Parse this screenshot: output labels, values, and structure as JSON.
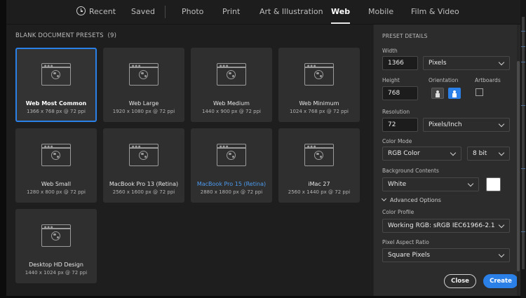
{
  "tabs": [
    {
      "label": "Recent",
      "icon": "clock-icon"
    },
    {
      "label": "Saved"
    },
    {
      "label": "Photo"
    },
    {
      "label": "Print"
    },
    {
      "label": "Art & Illustration"
    },
    {
      "label": "Web",
      "active": true
    },
    {
      "label": "Mobile"
    },
    {
      "label": "Film & Video"
    }
  ],
  "presets": {
    "header": "BLANK DOCUMENT PRESETS",
    "count": "(9)",
    "items": [
      {
        "name": "Web Most Common",
        "size": "1366 x 768 px @ 72 ppi",
        "selected": true
      },
      {
        "name": "Web Large",
        "size": "1920 x 1080 px @ 72 ppi"
      },
      {
        "name": "Web Medium",
        "size": "1440 x 900 px @ 72 ppi"
      },
      {
        "name": "Web Minimum",
        "size": "1024 x 768 px @ 72 ppi"
      },
      {
        "name": "Web Small",
        "size": "1280 x 800 px @ 72 ppi"
      },
      {
        "name": "MacBook Pro 13 (Retina)",
        "size": "2560 x 1600 px @ 72 ppi"
      },
      {
        "name": "MacBook Pro 15 (Retina)",
        "size": "2880 x 1800 px @ 72 ppi",
        "highlighted": true
      },
      {
        "name": "iMac 27",
        "size": "2560 x 1440 px @ 72 ppi"
      },
      {
        "name": "Desktop HD Design",
        "size": "1440 x 1024 px @ 72 ppi"
      }
    ]
  },
  "details": {
    "title": "PRESET DETAILS",
    "width_label": "Width",
    "width_value": "1366",
    "width_unit": "Pixels",
    "height_label": "Height",
    "height_value": "768",
    "orientation_label": "Orientation",
    "orientation_selected": "landscape",
    "artboards_label": "Artboards",
    "artboards_checked": false,
    "resolution_label": "Resolution",
    "resolution_value": "72",
    "resolution_unit": "Pixels/Inch",
    "color_mode_label": "Color Mode",
    "color_mode": "RGB Color",
    "bit_depth": "8 bit",
    "background_label": "Background Contents",
    "background": "White",
    "background_swatch": "#ffffff",
    "advanced_label": "Advanced Options",
    "color_profile_label": "Color Profile",
    "color_profile": "Working RGB: sRGB IEC61966-2.1",
    "pixel_aspect_label": "Pixel Aspect Ratio",
    "pixel_aspect": "Square Pixels"
  },
  "buttons": {
    "close": "Close",
    "create": "Create"
  },
  "colors": {
    "accent": "#2b80e8",
    "panel": "#2c2c2c",
    "background": "#1e1e1e"
  }
}
